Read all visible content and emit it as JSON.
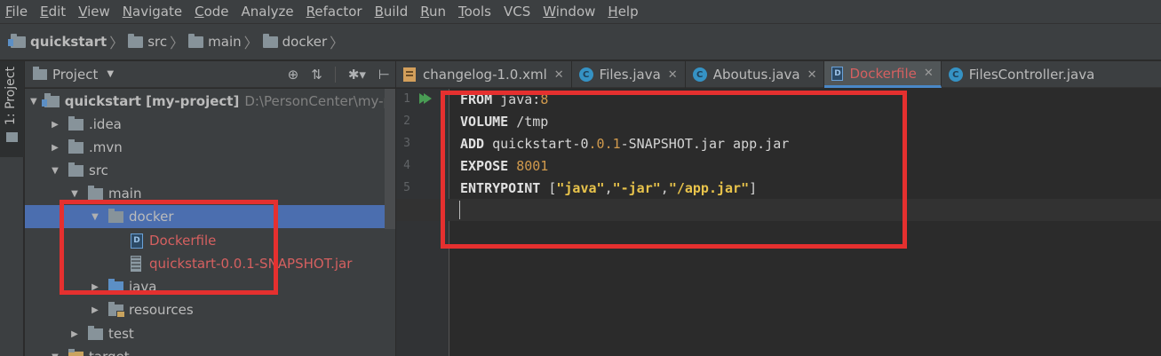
{
  "menu": [
    {
      "u": "F",
      "rest": "ile"
    },
    {
      "u": "E",
      "rest": "dit"
    },
    {
      "u": "V",
      "rest": "iew"
    },
    {
      "u": "N",
      "rest": "avigate"
    },
    {
      "u": "C",
      "rest": "ode"
    },
    {
      "u": "",
      "rest": "Analyze"
    },
    {
      "u": "R",
      "rest": "efactor"
    },
    {
      "u": "B",
      "rest": "uild"
    },
    {
      "u": "R",
      "rest": "un"
    },
    {
      "u": "T",
      "rest": "ools"
    },
    {
      "u": "",
      "rest": "VCS"
    },
    {
      "u": "W",
      "rest": "indow"
    },
    {
      "u": "H",
      "rest": "elp"
    }
  ],
  "breadcrumb": [
    "quickstart",
    "src",
    "main",
    "docker"
  ],
  "stripe_label": "1: Project",
  "project_panel": {
    "title": "Project",
    "caret": "▼",
    "tools": [
      "⊕",
      "⇅",
      "✱▾",
      "⊢"
    ]
  },
  "tree": [
    {
      "name": "quickstart [my-project]",
      "path": "D:\\PersonCenter\\my-proje"
    },
    {
      "name": ".idea"
    },
    {
      "name": ".mvn"
    },
    {
      "name": "src"
    },
    {
      "name": "main"
    },
    {
      "name": "docker"
    },
    {
      "name": "Dockerfile"
    },
    {
      "name": "quickstart-0.0.1-SNAPSHOT.jar"
    },
    {
      "name": "java"
    },
    {
      "name": "resources"
    },
    {
      "name": "test"
    },
    {
      "name": "target"
    }
  ],
  "tabs": [
    {
      "label": "changelog-1.0.xml",
      "icon": "xml-file-icon"
    },
    {
      "label": "Files.java",
      "icon": "class-icon"
    },
    {
      "label": "Aboutus.java",
      "icon": "class-icon"
    },
    {
      "label": "Dockerfile",
      "icon": "dockerfile-icon",
      "active": true
    },
    {
      "label": "FilesController.java",
      "icon": "class-icon"
    }
  ],
  "tab_close": "✕",
  "icon_letters": {
    "class": "C",
    "docker": "D"
  },
  "line_numbers": [
    "1",
    "2",
    "3",
    "4",
    "5"
  ],
  "code": {
    "l1_kw": "FROM",
    "l1_a": " java:",
    "l1_num": "8",
    "l2_kw": "VOLUME",
    "l2_a": " /tmp",
    "l3_kw": "ADD",
    "l3_a": " quickstart-",
    "l3_n1": "0",
    "l3_d1": ".",
    "l3_n2": "0",
    "l3_d2": ".",
    "l3_n3": "1",
    "l3_b": "-SNAPSHOT.jar app.jar",
    "l4_kw": "EXPOSE",
    "l4_sp": " ",
    "l4_num": "8001",
    "l5_kw": "ENTRYPOINT",
    "l5_a": " [",
    "l5_s1": "\"java\"",
    "l5_c1": ",",
    "l5_s2": "\"-jar\"",
    "l5_c2": ",",
    "l5_s3": "\"/app.jar\"",
    "l5_b": "]"
  },
  "colors": {
    "highlight": "#e5302f",
    "selection": "#4b6eaf",
    "modified_file": "#d56060"
  }
}
